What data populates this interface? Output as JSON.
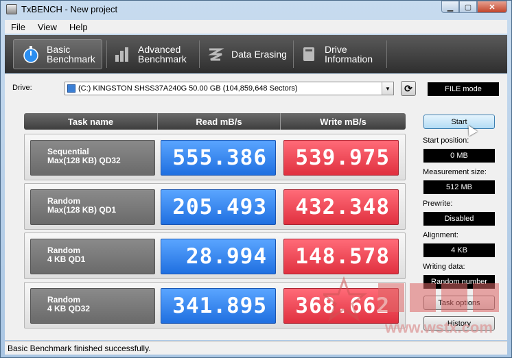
{
  "window": {
    "title": "TxBENCH - New project"
  },
  "window_buttons": {
    "minimize": "▁",
    "maximize": "▢",
    "close": "✕"
  },
  "menu": [
    "File",
    "View",
    "Help"
  ],
  "tabs": [
    {
      "line1": "Basic",
      "line2": "Benchmark",
      "icon": "stopwatch-icon",
      "active": true
    },
    {
      "line1": "Advanced",
      "line2": "Benchmark",
      "icon": "bar-chart-icon",
      "active": false
    },
    {
      "line1": "Data Erasing",
      "line2": "",
      "icon": "eraser-icon",
      "active": false
    },
    {
      "line1": "Drive",
      "line2": "Information",
      "icon": "drive-icon",
      "active": false
    }
  ],
  "drive": {
    "label": "Drive:",
    "selected": "(C:) KINGSTON SHSS37A240G  50.00 GB (104,859,648 Sectors)"
  },
  "mode": "FILE mode",
  "table": {
    "headers": [
      "Task name",
      "Read mB/s",
      "Write mB/s"
    ],
    "rows": [
      {
        "task1": "Sequential",
        "task2": "Max(128 KB) QD32",
        "read": "555.386",
        "write": "539.975"
      },
      {
        "task1": "Random",
        "task2": "Max(128 KB) QD1",
        "read": "205.493",
        "write": "432.348"
      },
      {
        "task1": "Random",
        "task2": "4 KB QD1",
        "read": "28.994",
        "write": "148.578"
      },
      {
        "task1": "Random",
        "task2": "4 KB QD32",
        "read": "341.895",
        "write": "368.662"
      }
    ]
  },
  "side": {
    "start": "Start",
    "start_position_label": "Start position:",
    "start_position": "0 MB",
    "measurement_size_label": "Measurement size:",
    "measurement_size": "512 MB",
    "prewrite_label": "Prewrite:",
    "prewrite": "Disabled",
    "alignment_label": "Alignment:",
    "alignment": "4 KB",
    "writing_data_label": "Writing data:",
    "writing_data": "Random number",
    "task_options": "Task options",
    "history": "History"
  },
  "status": "Basic Benchmark finished successfully.",
  "watermark": "www.wstx.com"
}
